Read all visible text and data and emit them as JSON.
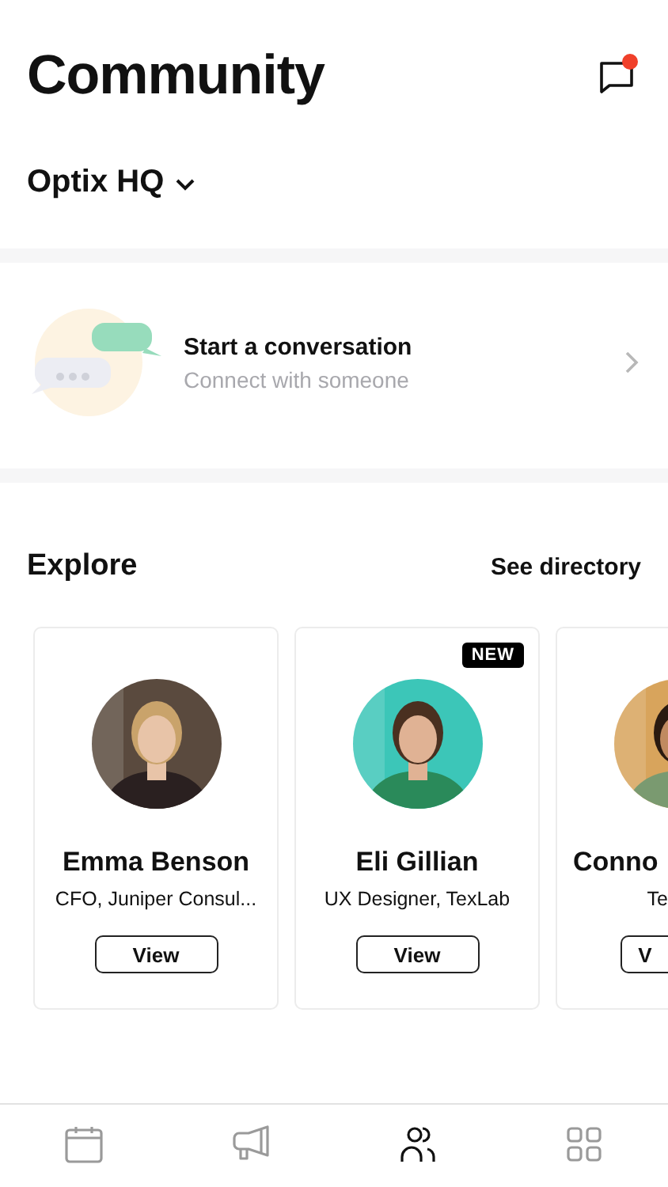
{
  "header": {
    "title": "Community",
    "org": "Optix HQ",
    "messages_unread": true
  },
  "conversation": {
    "title": "Start a conversation",
    "subtitle": "Connect with someone"
  },
  "explore": {
    "title": "Explore",
    "link": "See directory",
    "people": [
      {
        "name": "Emma Benson",
        "role": "CFO, Juniper Consul...",
        "button": "View"
      },
      {
        "name": "Eli Gillian",
        "role": "UX Designer, TexLab",
        "button": "View",
        "badge": "NEW"
      },
      {
        "name": "Conno",
        "role": "Te",
        "button": "V"
      }
    ]
  },
  "tabs": [
    {
      "kind": "calendar",
      "selected": false
    },
    {
      "kind": "megaphone",
      "selected": false
    },
    {
      "kind": "people",
      "selected": true
    },
    {
      "kind": "grid",
      "selected": false
    }
  ]
}
